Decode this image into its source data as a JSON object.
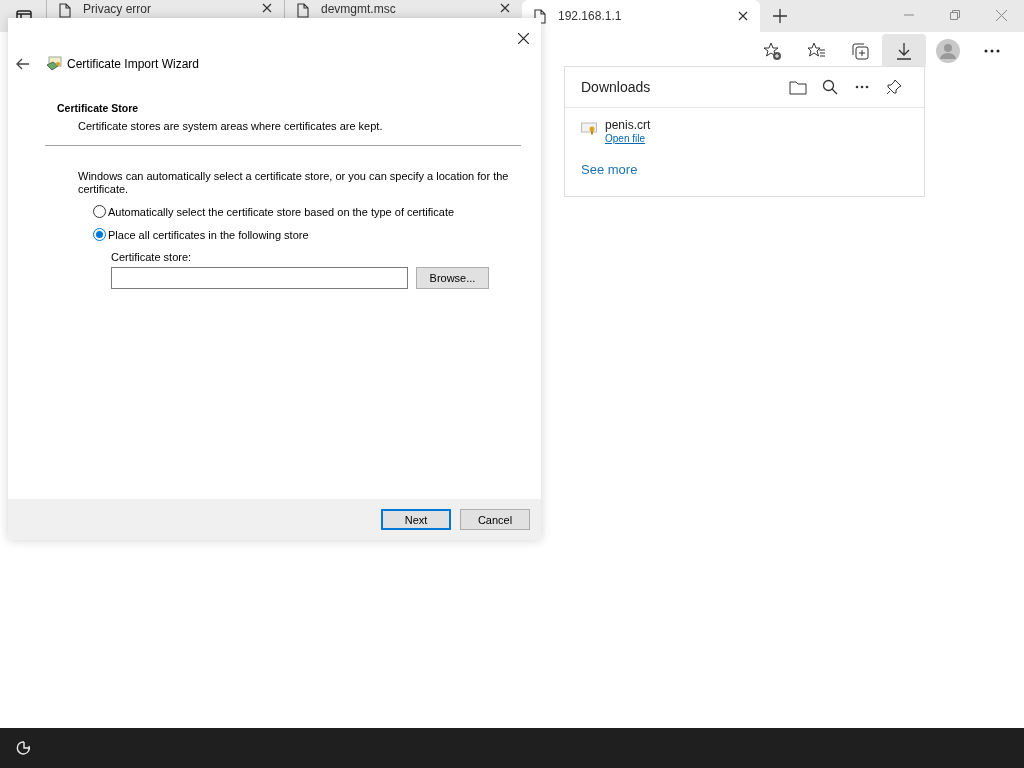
{
  "browser": {
    "tabs": [
      {
        "title": "Privacy error",
        "selected": false
      },
      {
        "title": "devmgmt.msc",
        "selected": false
      },
      {
        "title": "192.168.1.1",
        "selected": true
      }
    ]
  },
  "downloads": {
    "title": "Downloads",
    "items": [
      {
        "name": "penis.crt",
        "action": "Open file"
      }
    ],
    "see_more": "See more"
  },
  "wizard": {
    "title": "Certificate Import Wizard",
    "heading": "Certificate Store",
    "subheading": "Certificate stores are system areas where certificates are kept.",
    "intro": "Windows can automatically select a certificate store, or you can specify a location for the certificate.",
    "options": [
      {
        "label": "Automatically select the certificate store based on the type of certificate",
        "selected": false
      },
      {
        "label": "Place all certificates in the following store",
        "selected": true
      }
    ],
    "store_label": "Certificate store:",
    "browse": "Browse...",
    "buttons": [
      {
        "label": "Next",
        "default": true
      },
      {
        "label": "Cancel",
        "default": false
      }
    ]
  }
}
